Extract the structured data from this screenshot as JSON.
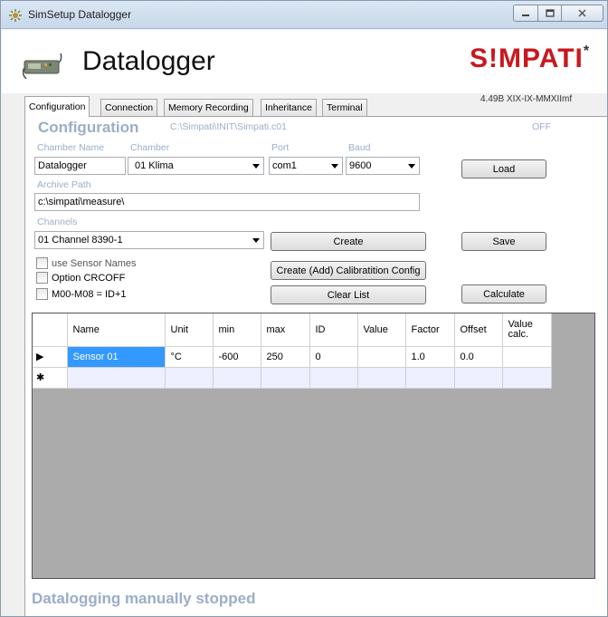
{
  "window": {
    "title": "SimSetup Datalogger",
    "controls": {
      "minimize": "—",
      "maximize": "□",
      "close": "✕"
    }
  },
  "header": {
    "app_title": "Datalogger",
    "logo_text": "S!MPATI",
    "logo_mark": "*",
    "version": "4.49B XIX-IX-MMXIImf",
    "logo_color": "#c8181e"
  },
  "tabs": [
    "Configuration",
    "Connection",
    "Memory Recording",
    "Inheritance",
    "Terminal"
  ],
  "config": {
    "heading": "Configuration",
    "file_path": "C:\\Simpati\\INIT\\Simpati.c01",
    "state": "OFF",
    "labels": {
      "chamber_name": "Chamber Name",
      "chamber": "Chamber",
      "port": "Port",
      "baud": "Baud",
      "archive_path": "Archive Path",
      "channels": "Channels"
    },
    "chamber_name": "Datalogger",
    "chamber": "01 Klima",
    "port": "com1",
    "baud": "9600",
    "archive_path": "c:\\simpati\\measure\\",
    "channel": "01 Channel  8390-1",
    "checkboxes": [
      "use Sensor Names",
      "Option CRCOFF",
      "M00-M08 = ID+1"
    ],
    "buttons": {
      "load": "Load",
      "create": "Create",
      "save": "Save",
      "create_calib": "Create (Add) Calibratition Config",
      "clear_list": "Clear List",
      "calculate": "Calculate"
    }
  },
  "grid": {
    "columns": [
      "Name",
      "Unit",
      "min",
      "max",
      "ID",
      "Value",
      "Factor",
      "Offset",
      "Value calc."
    ],
    "rows": [
      {
        "marker": "▶",
        "cells": [
          "Sensor 01",
          "°C",
          "-600",
          "250",
          "0",
          "",
          "1.0",
          "0.0",
          ""
        ]
      }
    ],
    "new_row_marker": "✱"
  },
  "status": "Datalogging manually stopped"
}
